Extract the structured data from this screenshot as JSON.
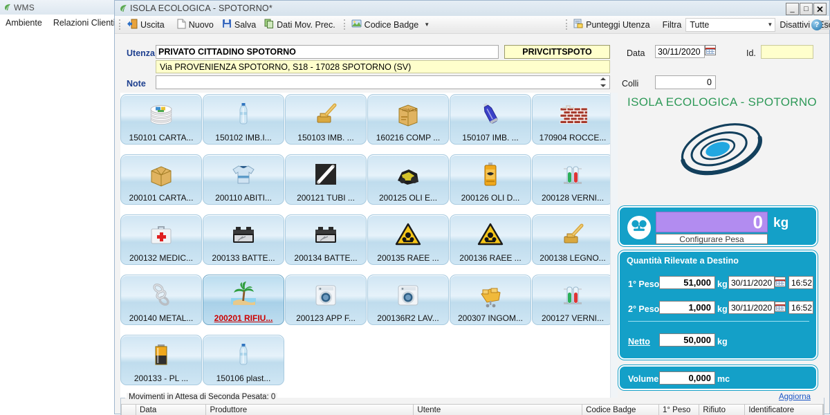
{
  "parent_window": {
    "title": "WMS",
    "leaf_icon": "leaf-icon",
    "menu": [
      "Ambiente",
      "Relazioni Clienti"
    ]
  },
  "window": {
    "title": "ISOLA ECOLOGICA - SPOTORNO*",
    "leaf_icon": "leaf-icon",
    "minimize_label": "_",
    "maximize_label": "□",
    "close_label": "✕"
  },
  "toolbar": {
    "uscita": "Uscita",
    "nuovo": "Nuovo",
    "salva": "Salva",
    "dati_mov_prec": "Dati Mov. Prec.",
    "codice_badge": "Codice Badge",
    "punteggi_utenza": "Punteggi Utenza",
    "filtra": "Filtra",
    "filtra_value": "Tutte",
    "disattivi": "Disattivi",
    "esclusi": "Esclusi",
    "help": "?"
  },
  "form": {
    "utenza_label": "Utenza",
    "utenza_value": "PRIVATO CITTADINO SPOTORNO",
    "codice_value": "PRIVCITTSPOTO",
    "indirizzo_value": "Via PROVENIENZA SPOTORNO, S18 - 17028 SPOTORNO (SV)",
    "note_label": "Note",
    "note_value": "",
    "data_label": "Data",
    "data_value": "30/11/2020",
    "id_label": "Id.",
    "id_value": "",
    "colli_label": "Colli",
    "colli_value": "0"
  },
  "tiles": [
    {
      "label": "150101 CARTA...",
      "icon": "paper-stack-icon",
      "selected": false
    },
    {
      "label": "150102 IMB.I...",
      "icon": "plastic-bottle-icon",
      "selected": false
    },
    {
      "label": "150103 IMB. ...",
      "icon": "wood-stamp-icon",
      "selected": false
    },
    {
      "label": "160216 COMP ...",
      "icon": "fragile-box-icon",
      "selected": false
    },
    {
      "label": "150107 IMB. ...",
      "icon": "glass-bottle-icon",
      "selected": false
    },
    {
      "label": "170904 ROCCE...",
      "icon": "brick-wall-icon",
      "selected": false
    },
    {
      "label": "200101 CARTA...",
      "icon": "cardboard-box-icon",
      "selected": false
    },
    {
      "label": "200110 ABITI...",
      "icon": "tshirt-icon",
      "selected": false
    },
    {
      "label": "200121 TUBI ...",
      "icon": "fluorescent-tube-icon",
      "selected": false
    },
    {
      "label": "200125 OLI E...",
      "icon": "engine-oil-icon",
      "selected": false
    },
    {
      "label": "200126 OLI D...",
      "icon": "oil-can-icon",
      "selected": false
    },
    {
      "label": "200128 VERNI...",
      "icon": "test-tubes-icon",
      "selected": false
    },
    {
      "label": "200132 MEDIC...",
      "icon": "first-aid-kit-icon",
      "selected": false
    },
    {
      "label": "200133 BATTE...",
      "icon": "car-battery-icon",
      "selected": false
    },
    {
      "label": "200134 BATTE...",
      "icon": "car-battery-icon",
      "selected": false
    },
    {
      "label": "200135 RAEE ...",
      "icon": "toxic-warning-icon",
      "selected": false
    },
    {
      "label": "200136 RAEE ...",
      "icon": "toxic-warning-icon",
      "selected": false
    },
    {
      "label": "200138 LEGNO...",
      "icon": "wood-stamp-icon",
      "selected": false
    },
    {
      "label": "200140 METAL...",
      "icon": "metal-chain-icon",
      "selected": false
    },
    {
      "label": "200201 RIFIU...",
      "icon": "palm-island-icon",
      "selected": true
    },
    {
      "label": "200123 APP F...",
      "icon": "washing-machine-icon",
      "selected": false
    },
    {
      "label": "200136R2 LAV...",
      "icon": "washing-machine-icon",
      "selected": false
    },
    {
      "label": "200307 INGOM...",
      "icon": "bulky-furniture-icon",
      "selected": false
    },
    {
      "label": "200127 VERNI...",
      "icon": "test-tubes-icon",
      "selected": false
    },
    {
      "label": "200133 - PL ...",
      "icon": "battery-icon",
      "selected": false
    },
    {
      "label": "150106 plast...",
      "icon": "plastic-bottle-icon",
      "selected": false
    }
  ],
  "brand": {
    "title": "ISOLA ECOLOGICA - SPOTORNO",
    "title_color": "#2e9958",
    "logo": "swirl-e-logo"
  },
  "scale": {
    "icon": "weighing-scale-icon",
    "display_value": "0",
    "unit": "kg",
    "configure_label": "Configurare Pesa",
    "display_bg": "#b28cf0"
  },
  "quantities": {
    "title": "Quantità Rilevate a Destino",
    "peso1_label": "1° Peso",
    "peso1_value": "51,000",
    "peso1_unit": "kg",
    "peso1_date": "30/11/2020",
    "peso1_time": "16:52",
    "peso2_label": "2° Peso",
    "peso2_value": "1,000",
    "peso2_unit": "kg",
    "peso2_date": "30/11/2020",
    "peso2_time": "16:52",
    "netto_label": "Netto",
    "netto_value": "50,000",
    "netto_unit": "kg",
    "panel_bg": "#14a0c8"
  },
  "volume": {
    "label": "Volume",
    "value": "0,000",
    "unit": "mc"
  },
  "bottom": {
    "groupbox_title": "Movimenti in Attesa di Seconda Pesata: 0",
    "refresh_link": "Aggiorna",
    "columns": [
      "",
      "Data",
      "Produttore",
      "Utente",
      "Codice Badge",
      "1° Peso",
      "Rifiuto",
      "Identificatore"
    ]
  }
}
